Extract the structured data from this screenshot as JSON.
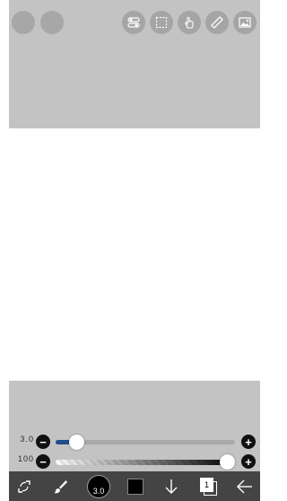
{
  "top_toolbar": {
    "left_buttons": [
      {
        "name": "circle-button-1"
      },
      {
        "name": "circle-button-2"
      }
    ],
    "right_icons": [
      "toggle-icon",
      "selection-icon",
      "hand-icon",
      "ruler-icon",
      "image-icon"
    ]
  },
  "brush_slider": {
    "value": "3.0",
    "minus": "−",
    "plus": "+",
    "level_percent": 8
  },
  "opacity_slider": {
    "value": "100",
    "minus": "−",
    "plus": "+",
    "level_percent": 100
  },
  "bottom_toolbar": {
    "brush_size_label": "3.0",
    "layer_count": "1",
    "icons": [
      "transform-icon",
      "brush-icon",
      "brush-size-icon",
      "color-icon",
      "arrow-down-icon",
      "layers-icon",
      "back-arrow-icon"
    ]
  },
  "colors": {
    "panel": "#c3c3c3",
    "bar": "#444444",
    "accent": "#1f4e8b"
  }
}
